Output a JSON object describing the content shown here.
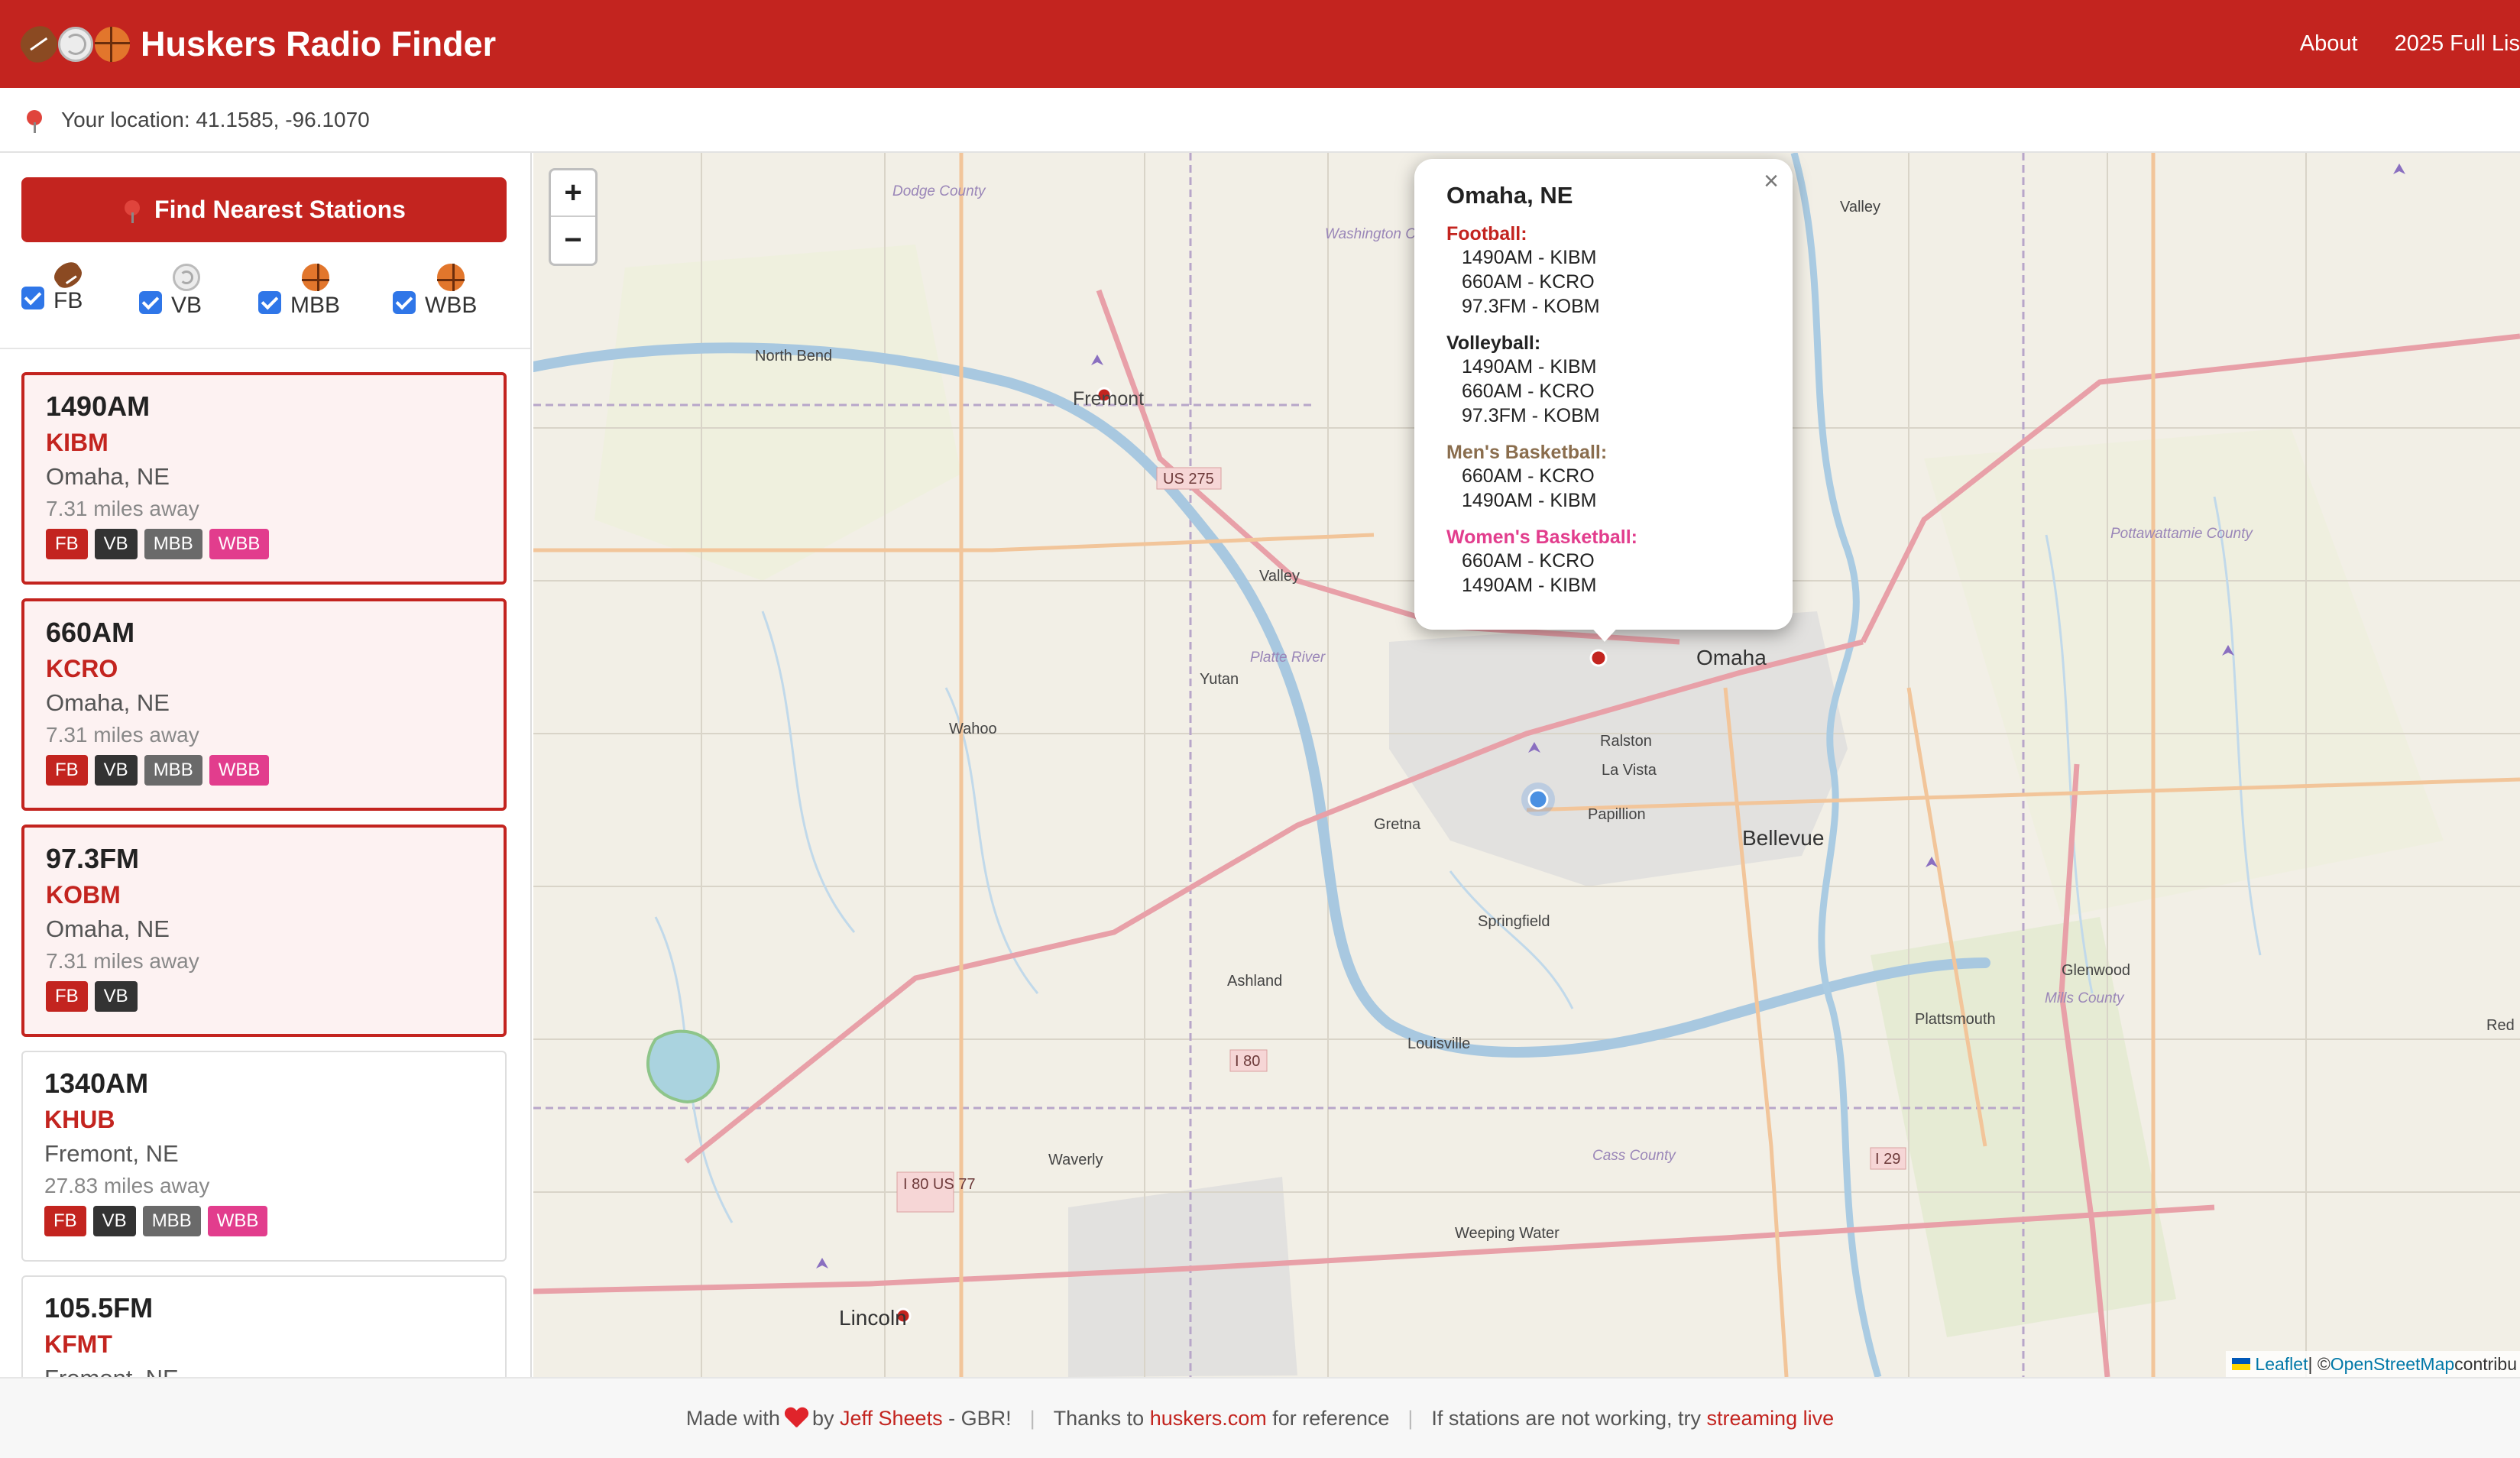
{
  "app": {
    "title": "Huskers Radio Finder",
    "nav": [
      "About",
      "2025 Full Lis"
    ]
  },
  "location": {
    "text": "Your location: 41.1585, -96.1070"
  },
  "sidebar": {
    "find_button": "Find Nearest Stations",
    "filters": [
      {
        "label": "FB",
        "icon": "football-icon",
        "checked": true
      },
      {
        "label": "VB",
        "icon": "volleyball-icon",
        "checked": true
      },
      {
        "label": "MBB",
        "icon": "basketball-icon",
        "checked": true
      },
      {
        "label": "WBB",
        "icon": "basketball-icon",
        "checked": true
      }
    ],
    "stations": [
      {
        "freq": "1490AM",
        "call": "KIBM",
        "city": "Omaha, NE",
        "distance": "7.31 miles away",
        "badges": [
          "FB",
          "VB",
          "MBB",
          "WBB"
        ],
        "active": true
      },
      {
        "freq": "660AM",
        "call": "KCRO",
        "city": "Omaha, NE",
        "distance": "7.31 miles away",
        "badges": [
          "FB",
          "VB",
          "MBB",
          "WBB"
        ],
        "active": true
      },
      {
        "freq": "97.3FM",
        "call": "KOBM",
        "city": "Omaha, NE",
        "distance": "7.31 miles away",
        "badges": [
          "FB",
          "VB"
        ],
        "active": true
      },
      {
        "freq": "1340AM",
        "call": "KHUB",
        "city": "Fremont, NE",
        "distance": "27.83 miles away",
        "badges": [
          "FB",
          "VB",
          "MBB",
          "WBB"
        ],
        "active": false
      },
      {
        "freq": "105.5FM",
        "call": "KFMT",
        "city": "Fremont, NE",
        "distance": "",
        "badges": [],
        "active": false
      }
    ]
  },
  "map": {
    "zoom_in": "+",
    "zoom_out": "−",
    "labels": {
      "dodge": "Dodge County",
      "washington": "Washington County",
      "north_bend": "North Bend",
      "fremont": "Fremont",
      "us275": "US 275",
      "valley": "Valley",
      "yutan": "Yutan",
      "platte": "Platte River",
      "wahoo": "Wahoo",
      "omaha": "Omaha",
      "ralston": "Ralston",
      "la_vista": "La Vista",
      "papillion": "Papillion",
      "bellevue": "Bellevue",
      "gretna": "Gretna",
      "springfield": "Springfield",
      "ashland": "Ashland",
      "louisville": "Louisville",
      "i80": "I 80",
      "i80_us77": "I 80 US 77",
      "waverly": "Waverly",
      "cass": "Cass County",
      "weeping_water": "Weeping Water",
      "lincoln": "Lincoln",
      "glenwood": "Glenwood",
      "plattsmouth": "Plattsmouth",
      "mills": "Mills County",
      "i29": "I 29",
      "pottawattamie": "Pottawattamie County",
      "valley_ia": "Valley",
      "red": "Red"
    },
    "attribution": {
      "leaflet": "Leaflet",
      "sep": " | © ",
      "osm": "OpenStreetMap",
      "rest": " contribu"
    }
  },
  "popup": {
    "title": "Omaha, NE",
    "sections": [
      {
        "label": "Football:",
        "stations": [
          "1490AM - KIBM",
          "660AM - KCRO",
          "97.3FM - KOBM"
        ]
      },
      {
        "label": "Volleyball:",
        "stations": [
          "1490AM - KIBM",
          "660AM - KCRO",
          "97.3FM - KOBM"
        ]
      },
      {
        "label": "Men's Basketball:",
        "stations": [
          "660AM - KCRO",
          "1490AM - KIBM"
        ]
      },
      {
        "label": "Women's Basketball:",
        "stations": [
          "660AM - KCRO",
          "1490AM - KIBM"
        ]
      }
    ],
    "close": "×"
  },
  "footer": {
    "made_with": "Made with",
    "by": "by",
    "author": "Jeff Sheets",
    "gbr": "- GBR!",
    "thanks": "Thanks to",
    "site": "huskers.com",
    "for_ref": "for reference",
    "not_working": "If stations are not working, try",
    "streaming": "streaming live"
  },
  "colors": {
    "brand": "#c3241f",
    "wbb": "#e23d8d",
    "vb": "#333333",
    "mbb": "#6a6a6a"
  }
}
